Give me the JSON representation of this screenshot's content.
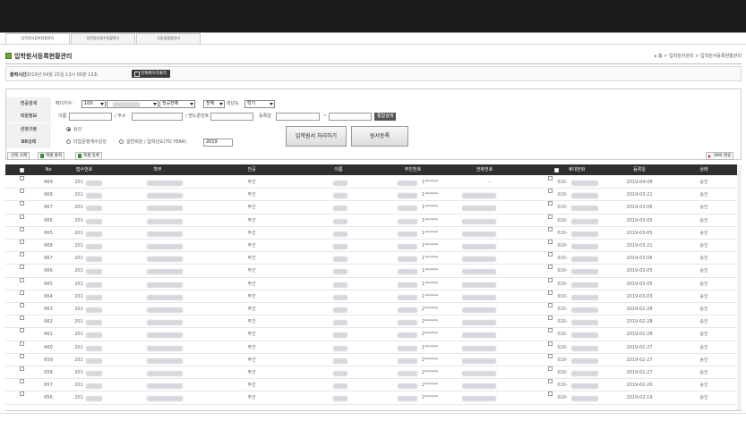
{
  "tabs": [
    "입학원서등록현황관리",
    "입학원서접수현황관리",
    "신입생결품관리"
  ],
  "page": {
    "title": "입학원서등록현황관리",
    "breadcrumb": "▸ 홈 > 입학원서관리 > 입학원서등록현황관리",
    "time_label": "출력시간",
    "time_value": "2019년 04월 25일 13시 05분 13초",
    "print_button": "현재페이지출력"
  },
  "search": {
    "row1_label": "전공검색",
    "page_count_label": "페이지수 :",
    "page_count_value": "100",
    "major_select": "전공전체",
    "type_select": "전체",
    "grade_label": "학년도",
    "semester_select": "학기",
    "row2_label": "회원정보",
    "name_label": "이름",
    "slash1": "/ 주소",
    "slash2": "/ 핸드폰번호",
    "date_label": "등록일",
    "dash": "~",
    "search_button": "통합검색",
    "row3_label": "선정구분",
    "row3_radio": "승인",
    "row4_label": "BB상태",
    "row4_radio1": "타업운행계수감성",
    "row4_radio2": "일반회원 / 입학년도(TO YEAR)",
    "year_value": "2019",
    "process_button": "입학원서 처리하기",
    "register_button": "원서등록"
  },
  "toolbar": {
    "delete_btn": "선택 삭제",
    "excel_out": "엑셀 출력",
    "excel_in": "엑셀 등록",
    "sms_btn": "SMS 발송"
  },
  "grid": {
    "headers": {
      "no": "No",
      "receipt": "접수번호",
      "dept": "학부",
      "major": "전공",
      "name": "이름",
      "resident": "주민번호",
      "phone": "전화번호",
      "mobile": "휴대전화",
      "regdate": "등록일",
      "status": "상태"
    },
    "rows": [
      {
        "no": "669",
        "rec": "201",
        "major": "주간",
        "res": "1******",
        "phone": "--",
        "mob": "010-",
        "date": "2019-04-08",
        "st": "승인"
      },
      {
        "no": "668",
        "rec": "201",
        "major": "주간",
        "res": "1******",
        "phone": "",
        "mob": "010-",
        "date": "2019-03-21",
        "st": "승인"
      },
      {
        "no": "667",
        "rec": "201",
        "major": "주간",
        "res": "1******",
        "phone": "",
        "mob": "010-",
        "date": "2019-03-06",
        "st": "승인"
      },
      {
        "no": "666",
        "rec": "201",
        "major": "주간",
        "res": "1******",
        "phone": "",
        "mob": "010-",
        "date": "2019-03-05",
        "st": "승인"
      },
      {
        "no": "665",
        "rec": "201",
        "major": "주간",
        "res": "1******",
        "phone": "",
        "mob": "010-",
        "date": "2019-03-05",
        "st": "승인"
      },
      {
        "no": "668",
        "rec": "201",
        "major": "주간",
        "res": "1******",
        "phone": "",
        "mob": "010-",
        "date": "2019-03-21",
        "st": "승인"
      },
      {
        "no": "667",
        "rec": "201",
        "major": "주간",
        "res": "1******",
        "phone": "",
        "mob": "010-",
        "date": "2019-03-06",
        "st": "승인"
      },
      {
        "no": "666",
        "rec": "201",
        "major": "주간",
        "res": "1******",
        "phone": "",
        "mob": "010-",
        "date": "2019-03-05",
        "st": "승인"
      },
      {
        "no": "665",
        "rec": "201",
        "major": "주간",
        "res": "1******",
        "phone": "",
        "mob": "010-",
        "date": "2019-03-05",
        "st": "승인"
      },
      {
        "no": "664",
        "rec": "201",
        "major": "주간",
        "res": "1******",
        "phone": "",
        "mob": "010-",
        "date": "2019-03-03",
        "st": "승인"
      },
      {
        "no": "663",
        "rec": "201",
        "major": "주간",
        "res": "2******",
        "phone": "",
        "mob": "010-",
        "date": "2019-02-28",
        "st": "승인"
      },
      {
        "no": "662",
        "rec": "201",
        "major": "주간",
        "res": "2******",
        "phone": "",
        "mob": "010-",
        "date": "2019-02-28",
        "st": "승인"
      },
      {
        "no": "661",
        "rec": "201",
        "major": "주간",
        "res": "2******",
        "phone": "",
        "mob": "010-",
        "date": "2019-02-28",
        "st": "승인"
      },
      {
        "no": "660",
        "rec": "201",
        "major": "주간",
        "res": "1******",
        "phone": "",
        "mob": "010-",
        "date": "2019-02-27",
        "st": "승인"
      },
      {
        "no": "659",
        "rec": "201",
        "major": "주간",
        "res": "2******",
        "phone": "",
        "mob": "010-",
        "date": "2019-02-27",
        "st": "승인"
      },
      {
        "no": "658",
        "rec": "201",
        "major": "주간",
        "res": "2******",
        "phone": "",
        "mob": "010-",
        "date": "2019-02-27",
        "st": "승인"
      },
      {
        "no": "657",
        "rec": "201",
        "major": "주간",
        "res": "2******",
        "phone": "",
        "mob": "010-",
        "date": "2019-02-20",
        "st": "승인"
      },
      {
        "no": "656",
        "rec": "201",
        "major": "주간",
        "res": "2******",
        "phone": "",
        "mob": "010-",
        "date": "2019-02-19",
        "st": "승인"
      }
    ]
  }
}
